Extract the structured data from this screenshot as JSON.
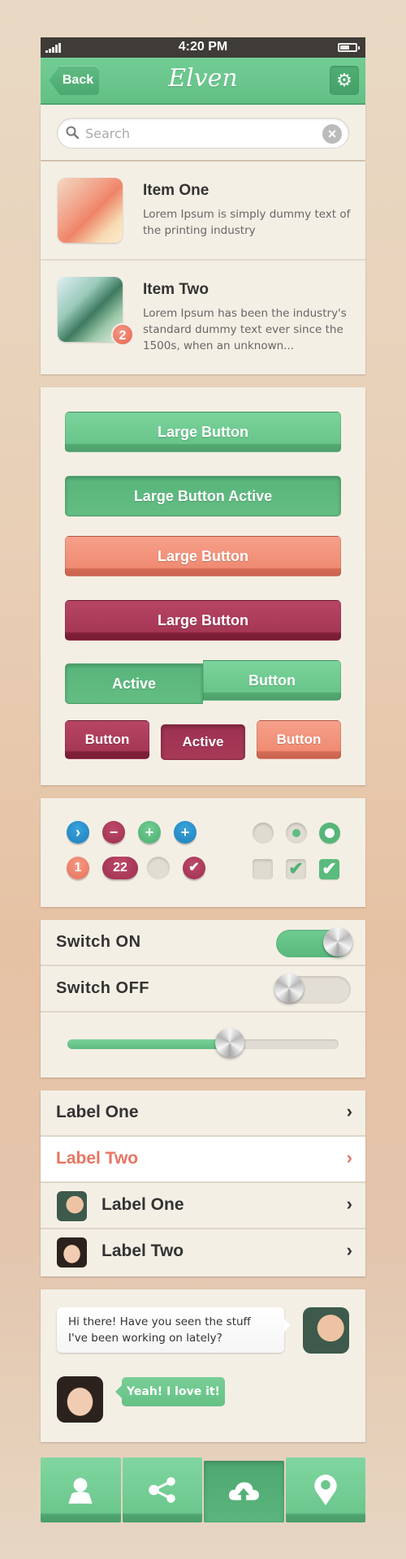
{
  "status_bar": {
    "time": "4:20 PM",
    "signal_icon": "signal-bars-icon",
    "battery_icon": "battery-icon"
  },
  "nav": {
    "back_label": "Back",
    "title": "Elven",
    "settings_icon": "gear-icon"
  },
  "search": {
    "placeholder": "Search",
    "value": "",
    "clear_icon": "close-icon"
  },
  "items": [
    {
      "title": "Item One",
      "description": "Lorem Ipsum is simply dummy text of the printing industry",
      "badge": null
    },
    {
      "title": "Item Two",
      "description": "Lorem Ipsum has been the industry's standard dummy text ever since the 1500s, when an unknown...",
      "badge": "2"
    }
  ],
  "buttons": {
    "large": [
      "Large Button",
      "Large Button Active",
      "Large Button",
      "Large Button"
    ],
    "segmented": [
      "Active",
      "Button"
    ],
    "small": [
      "Button",
      "Active",
      "Button"
    ]
  },
  "controls": {
    "circle_icons": [
      "chevron-right-icon",
      "minus-icon",
      "plus-icon",
      "plus-icon"
    ],
    "badges": [
      "1",
      "22"
    ],
    "radios": [
      "unchecked",
      "checked-dim",
      "checked"
    ],
    "checkboxes": [
      "unchecked",
      "checked-dim",
      "checked"
    ]
  },
  "switches": [
    {
      "label": "Switch  ON",
      "on": true
    },
    {
      "label": "Switch  OFF",
      "on": false
    }
  ],
  "slider": {
    "value": 0.6
  },
  "list": [
    {
      "label": "Label One",
      "selected": false,
      "avatar": null
    },
    {
      "label": "Label Two",
      "selected": true,
      "avatar": null
    },
    {
      "label": "Label One",
      "selected": false,
      "avatar": "male"
    },
    {
      "label": "Label Two",
      "selected": false,
      "avatar": "female"
    }
  ],
  "chat": [
    {
      "text": "Hi there! Have you seen the stuff I've been working on lately?",
      "from": "male"
    },
    {
      "text": "Yeah! I love it!",
      "from": "female"
    }
  ],
  "tabbar": [
    {
      "icon": "user-icon",
      "active": false
    },
    {
      "icon": "share-icon",
      "active": false
    },
    {
      "icon": "cloud-upload-icon",
      "active": true
    },
    {
      "icon": "location-pin-icon",
      "active": false
    }
  ],
  "colors": {
    "green": "#6bc78d",
    "coral": "#f08b72",
    "crimson": "#a53755",
    "blue": "#2a8fcb",
    "card": "#f4efe5"
  }
}
